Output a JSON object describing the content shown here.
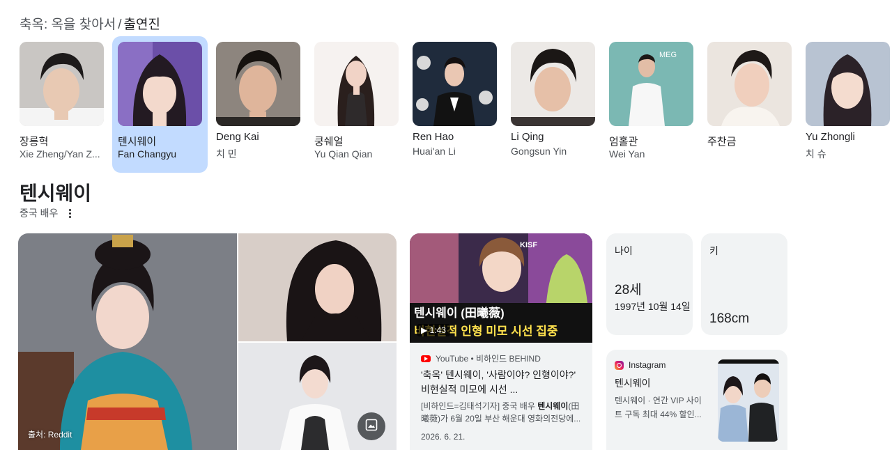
{
  "breadcrumb": {
    "parent": "축옥: 옥을 찾아서",
    "separator": "/",
    "current": "출연진"
  },
  "cast": [
    {
      "name": "장릉혁",
      "role": "Xie Zheng/Yan Z...",
      "selected": false
    },
    {
      "name": "텐시웨이",
      "role": "Fan Changyu",
      "selected": true
    },
    {
      "name": "Deng Kai",
      "role": "치 민",
      "selected": false
    },
    {
      "name": "쿵쉐얼",
      "role": "Yu Qian Qian",
      "selected": false
    },
    {
      "name": "Ren Hao",
      "role": "Huai'an Li",
      "selected": false
    },
    {
      "name": "Li Qing",
      "role": "Gongsun Yin",
      "selected": false
    },
    {
      "name": "엄홀관",
      "role": "Wei Yan",
      "selected": false
    },
    {
      "name": "주찬금",
      "role": "",
      "selected": false
    },
    {
      "name": "Yu Zhongli",
      "role": "치 슈",
      "selected": false
    }
  ],
  "entity": {
    "title": "텐시웨이",
    "subtitle": "중국 배우"
  },
  "gallery": {
    "source": "출처: Reddit",
    "image_icon": "image-icon"
  },
  "video": {
    "duration": "1:43",
    "source": "YouTube • 비하인드 BEHIND",
    "title": "'축옥' 텐시웨이, '사람이야? 인형이야?' 비현실적 미모에 시선 ...",
    "snippet_prefix": "[비하인드=김태석기자] 중국 배우 ",
    "snippet_bold": "텐시웨이",
    "snippet_suffix": "(田曦薇)가 6월 20일 부산 해운대 영화의전당에...",
    "date": "2026. 6. 21.",
    "thumb_caption": "텐시웨이 (田曦薇)",
    "thumb_sub": "비현실적 인형 미모 시선 집중",
    "thumb_badge": "KISF"
  },
  "facts": {
    "age_label": "나이",
    "age_value": "28세",
    "birth_date": "1997년 10월 14일",
    "height_label": "키",
    "height_value": "168cm"
  },
  "instagram": {
    "source": "Instagram",
    "title": "텐시웨이",
    "desc": "텐시웨이 · 연간 VIP 사이트 구독 최대 44% 할인..."
  },
  "colors": {
    "selected_bg": "#c2dbff",
    "card_bg": "#f1f3f4",
    "youtube_red": "#ff0000"
  }
}
